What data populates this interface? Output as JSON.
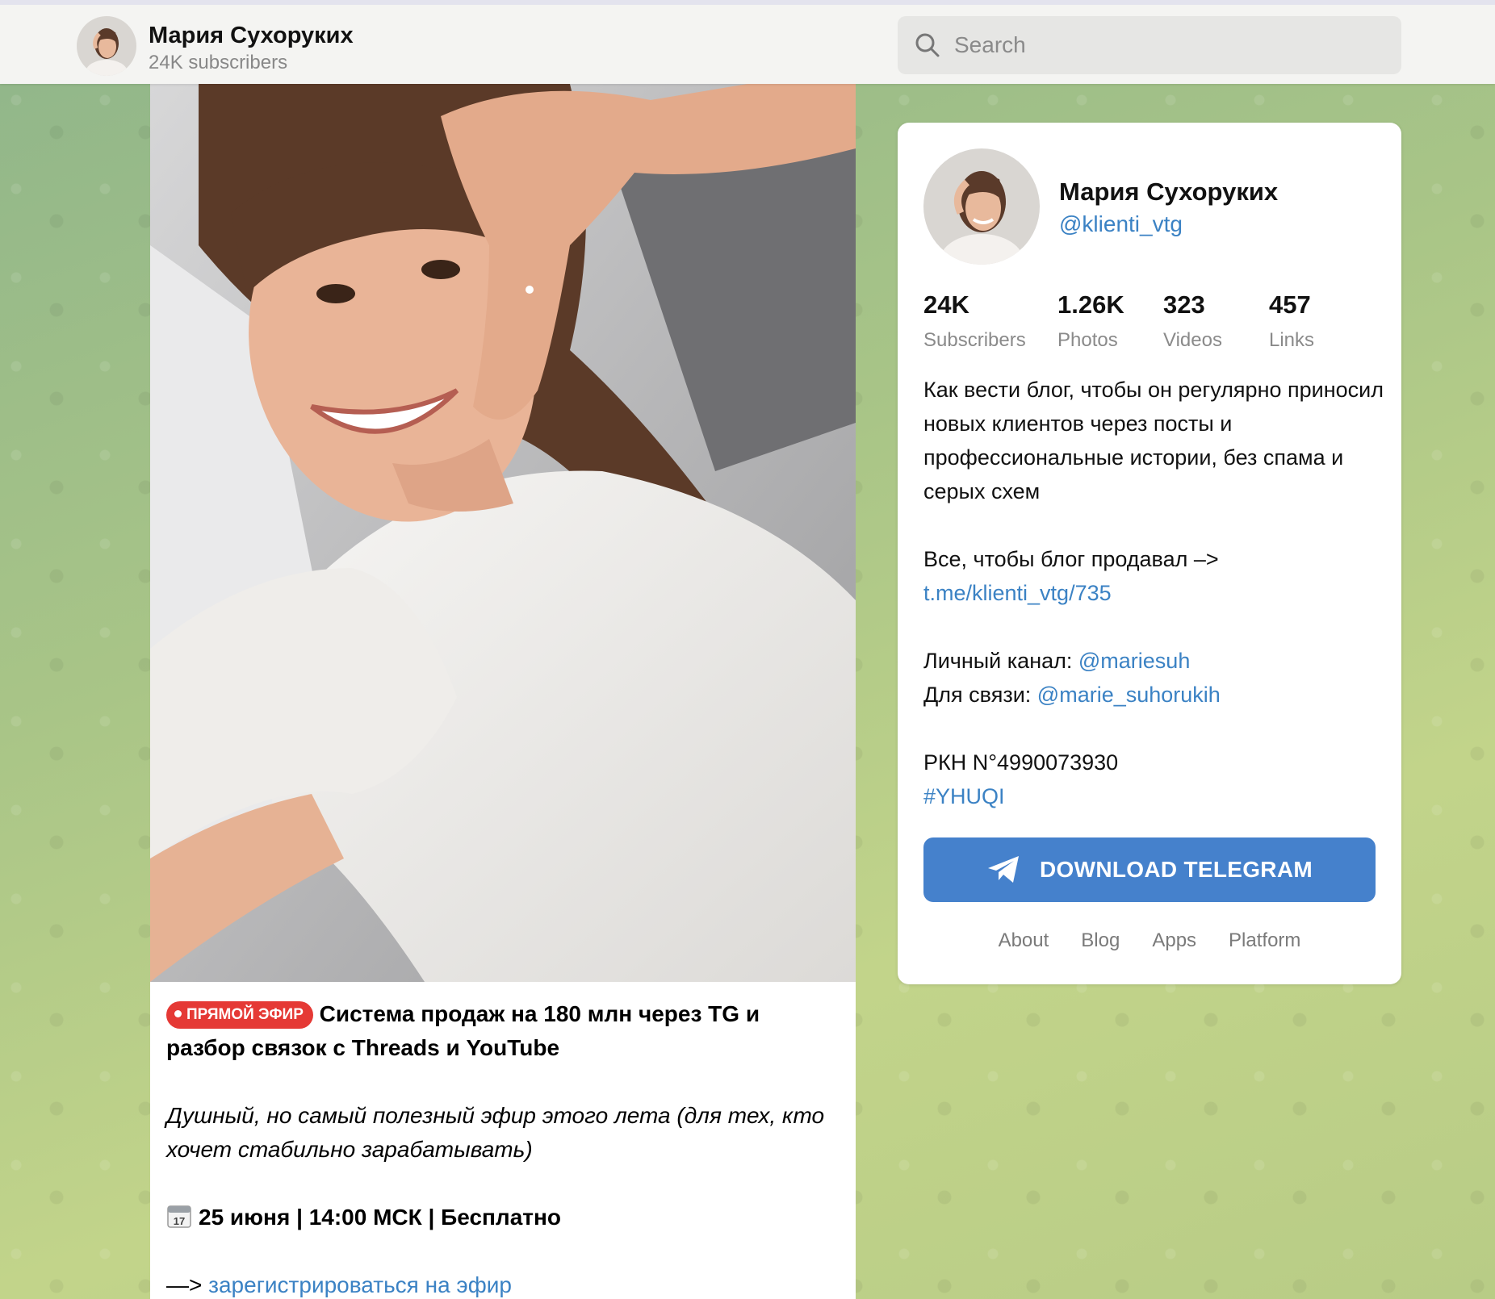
{
  "header": {
    "channel_name": "Мария Сухоруких",
    "subscribers": "24K subscribers",
    "search_placeholder": "Search"
  },
  "post": {
    "badge": "ПРЯМОЙ ЭФИР",
    "title": "Система продаж на 180 млн через TG и разбор связок с Threads и YouTube",
    "italic": "Душный, но самый полезный эфир этого лета (для тех, кто хочет стабильно зарабатывать)",
    "date_icon": "calendar-icon",
    "date": "25 июня | 14:00 МСК | Бесплатно",
    "register_prefix": "—> ",
    "register_link": "зарегистрироваться на эфир"
  },
  "card": {
    "name": "Мария Сухоруких",
    "handle": "@klienti_vtg",
    "stats": [
      {
        "value": "24K",
        "label": "Subscribers"
      },
      {
        "value": "1.26K",
        "label": "Photos"
      },
      {
        "value": "323",
        "label": "Videos"
      },
      {
        "value": "457",
        "label": "Links"
      }
    ],
    "description": "Как вести блог, чтобы он регулярно приносил новых клиентов через посты и профессиональные истории, без спама и серых схем",
    "sell_text": "Все, чтобы блог продавал –>",
    "sell_link": "t.me/klienti_vtg/735",
    "personal_label": "Личный канал: ",
    "personal_link": "@mariesuh",
    "contact_label": "Для связи: ",
    "contact_link": "@marie_suhorukih",
    "rkn": "РКН N°4990073930",
    "hashtag": "#YHUQI",
    "download_button": "DOWNLOAD TELEGRAM",
    "footer_links": [
      "About",
      "Blog",
      "Apps",
      "Platform"
    ]
  },
  "colors": {
    "accent": "#4581cc",
    "link": "#3b82c4",
    "live_badge": "#e53935"
  }
}
